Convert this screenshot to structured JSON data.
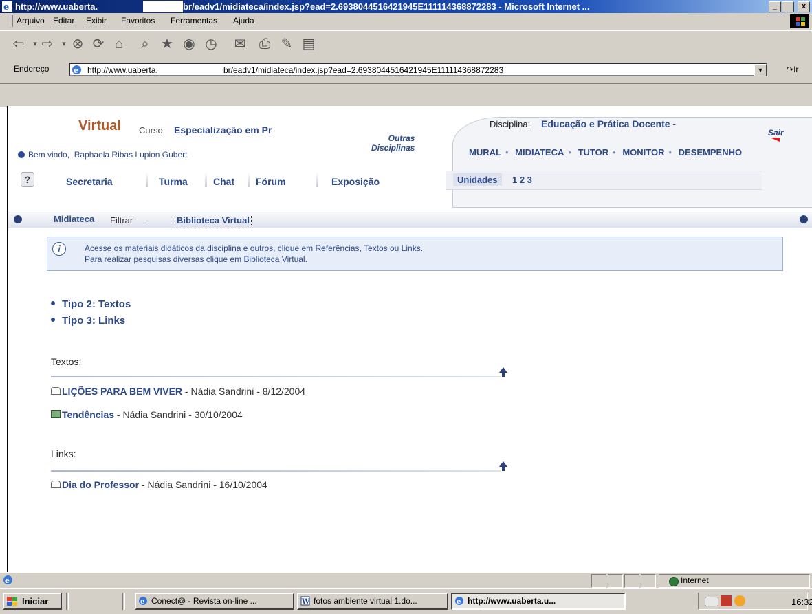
{
  "window": {
    "title_part1": "http://www.uaberta.",
    "title_part2": "br/eadv1/midiateca/index.jsp?ead=2.6938044516421945E111114368872283 - Microsoft Internet ...",
    "btn_min": "_",
    "btn_max": " ",
    "btn_close": "x"
  },
  "menu": {
    "items": [
      "Arquivo",
      "Editar",
      "Exibir",
      "Favoritos",
      "Ferramentas",
      "Ajuda"
    ]
  },
  "toolbar": {
    "icons": [
      "back-icon",
      "forward-icon",
      "stop-icon",
      "refresh-icon",
      "home-icon",
      "search-icon",
      "favorites-icon",
      "media-icon",
      "history-icon",
      "mail-icon",
      "print-icon",
      "edit-icon",
      "discuss-icon"
    ],
    "glyphs": [
      "⇦",
      "▾",
      "⇨",
      "▾",
      "⊗",
      "⟳",
      "⌂",
      "⌕",
      "★",
      "◉",
      "◷",
      "✉",
      "⎙",
      "✎",
      "▤"
    ]
  },
  "address": {
    "label": "Endereço",
    "url_part1": "http://www.uaberta.",
    "url_part2": "br/eadv1/midiateca/index.jsp?ead=2.6938044516421945E111114368872283",
    "go_label": "Ir",
    "dropdown_glyph": "▼"
  },
  "header": {
    "brand": "Virtual",
    "curso_label": "Curso:",
    "curso_value": "Especialização em Pr",
    "welcome_prefix": "Bem vindo,",
    "user_name": "Raphaela Ribas Lupion Gubert",
    "outras_line1": "Outras",
    "outras_line2": "Disciplinas",
    "disciplina_label": "Disciplina:",
    "disciplina_value": "Educação e Prática Docente -",
    "sair": "Sair",
    "topnav": [
      "MURAL",
      "MIDIATECA",
      "TUTOR",
      "MONITOR",
      "DESEMPENHO"
    ],
    "help": "?",
    "tabs": [
      "Secretaria",
      "Turma",
      "Chat",
      "Fórum",
      "Exposição"
    ],
    "unidades_label": "Unidades",
    "unidades_value": "1 2 3"
  },
  "midiateca": {
    "title": "Midiateca",
    "filtrar": "Filtrar",
    "dash": "-",
    "biblioteca": "Biblioteca Virtual"
  },
  "info": {
    "icon_glyph": "i",
    "line1": "Acesse os materiais didáticos da disciplina e outros, clique em Referências, Textos ou Links.",
    "line2": "Para realizar pesquisas diversas clique em Biblioteca Virtual."
  },
  "types": [
    "Tipo 2: Textos",
    "Tipo 3: Links"
  ],
  "sections": {
    "textos_title": "Textos:",
    "links_title": "Links:",
    "textos": [
      {
        "title": "LIÇÕES PARA BEM VIVER",
        "meta": " - Nádia Sandrini - 8/12/2004",
        "icon": "document-icon"
      },
      {
        "title": "Tendências",
        "meta": " - Nádia Sandrini - 30/10/2004",
        "icon": "envelope-icon"
      }
    ],
    "links": [
      {
        "title": "Dia do Professor",
        "meta": " - Nádia Sandrini - 16/10/2004",
        "icon": "document-icon"
      }
    ]
  },
  "status": {
    "zone": "Internet"
  },
  "taskbar": {
    "start": "Iniciar",
    "tasks": [
      "Conect@ - Revista on-line ...",
      "fotos ambiente virtual 1.do...",
      "http://www.uaberta.u..."
    ],
    "clock": "16:32"
  }
}
